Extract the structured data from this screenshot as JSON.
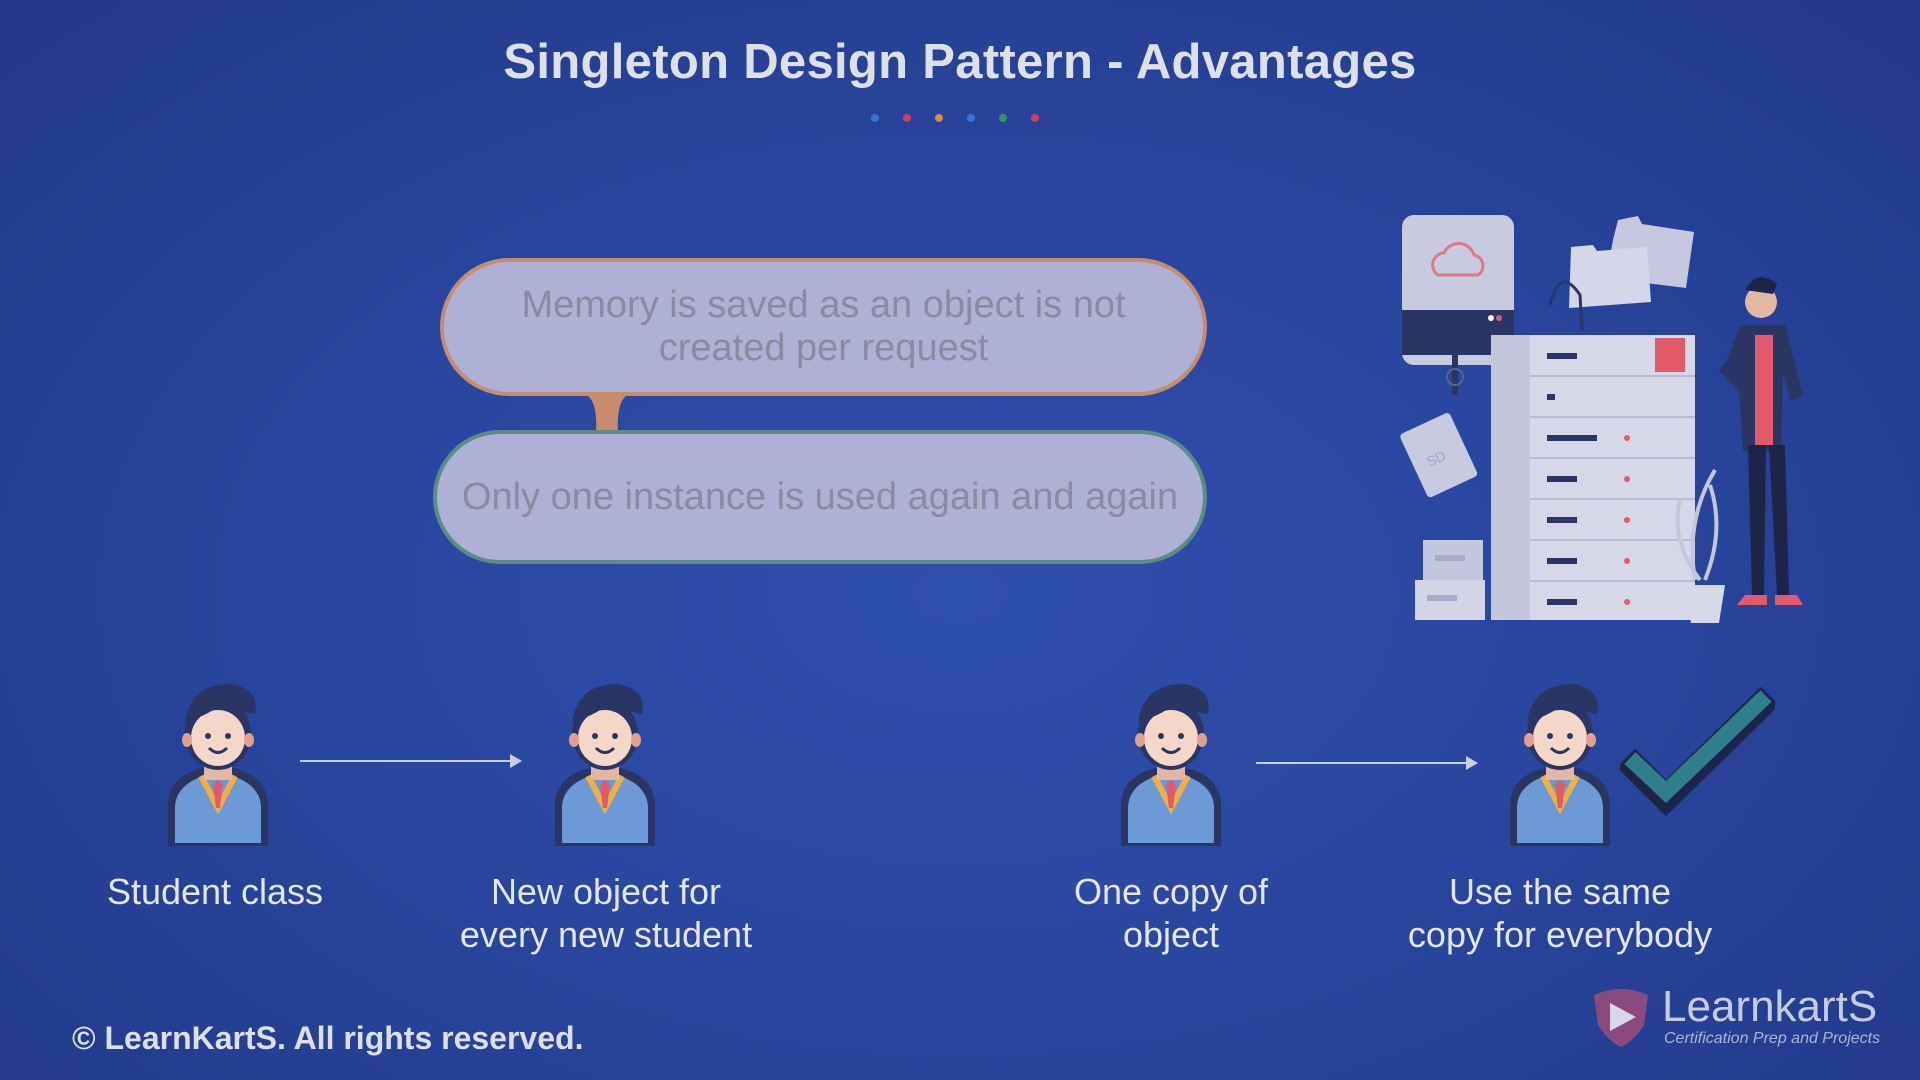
{
  "title": "Singleton Design Pattern - Advantages",
  "title_dots": [
    "#3d6fd6",
    "#d93a55",
    "#e08a3a",
    "#3d6fd6",
    "#2e9a5a",
    "#d93a55"
  ],
  "advantages": [
    "Memory is saved as an object is not\ncreated per request",
    "Only one instance is used again and again"
  ],
  "flow": {
    "student_class": "Student class",
    "new_object": "New object for\nevery new student",
    "one_copy": "One copy of\nobject",
    "same_copy": "Use the same\ncopy for everybody"
  },
  "icons": {
    "student": "student-icon",
    "check": "checkmark-icon",
    "server": "server-illustration"
  },
  "footer": "© LearnKartS. All rights reserved.",
  "logo": {
    "name": "LearnkartS",
    "tagline": "Certification Prep and Projects"
  }
}
